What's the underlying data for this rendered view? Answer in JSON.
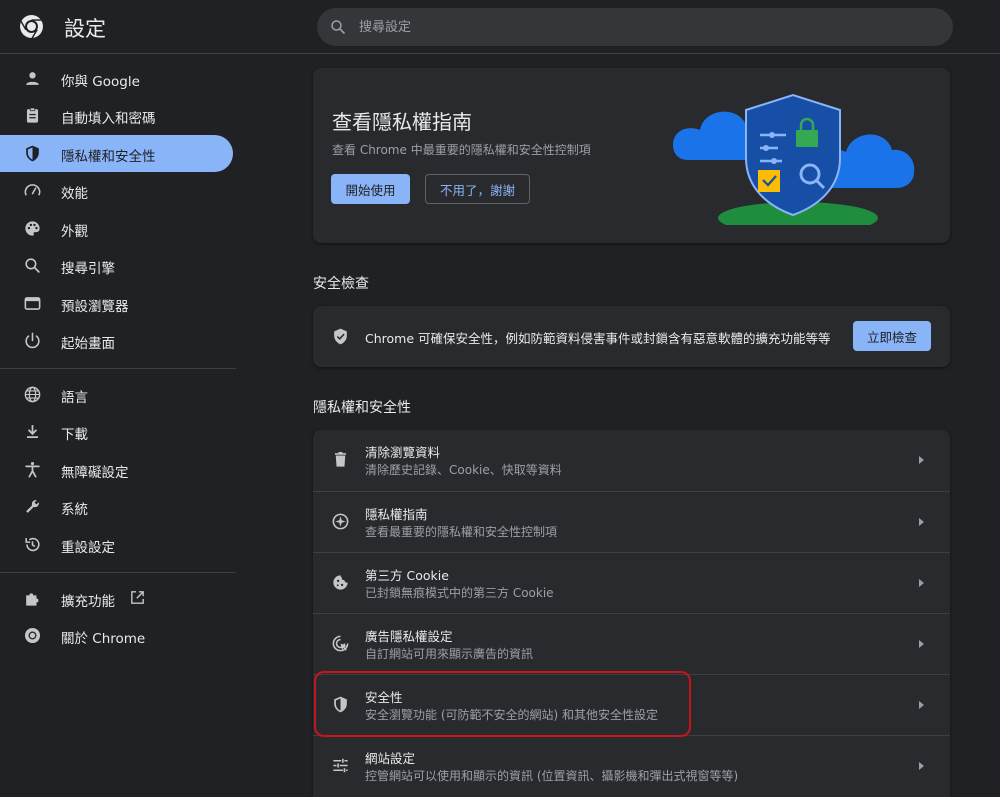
{
  "header": {
    "title": "設定",
    "search_placeholder": "搜尋設定"
  },
  "sidebar": {
    "items": [
      {
        "label": "你與 Google",
        "icon": "person-icon"
      },
      {
        "label": "自動填入和密碼",
        "icon": "clipboard-icon"
      },
      {
        "label": "隱私權和安全性",
        "icon": "shield-icon",
        "active": true
      },
      {
        "label": "效能",
        "icon": "speedometer-icon"
      },
      {
        "label": "外觀",
        "icon": "palette-icon"
      },
      {
        "label": "搜尋引擎",
        "icon": "search-icon"
      },
      {
        "label": "預設瀏覽器",
        "icon": "browser-icon"
      },
      {
        "label": "起始畫面",
        "icon": "power-icon"
      },
      {
        "label": "語言",
        "icon": "globe-icon"
      },
      {
        "label": "下載",
        "icon": "download-icon"
      },
      {
        "label": "無障礙設定",
        "icon": "accessibility-icon"
      },
      {
        "label": "系統",
        "icon": "wrench-icon"
      },
      {
        "label": "重設設定",
        "icon": "history-icon"
      },
      {
        "label": "擴充功能",
        "icon": "puzzle-icon"
      },
      {
        "label": "關於 Chrome",
        "icon": "chrome-icon"
      }
    ]
  },
  "promo": {
    "title": "查看隱私權指南",
    "description": "查看 Chrome 中最重要的隱私權和安全性控制項",
    "start_label": "開始使用",
    "dismiss_label": "不用了，謝謝"
  },
  "safety_check": {
    "heading": "安全檢查",
    "text": "Chrome 可確保安全性，例如防範資料侵害事件或封鎖含有惡意軟體的擴充功能等等",
    "button_label": "立即檢查"
  },
  "privacy": {
    "heading": "隱私權和安全性",
    "rows": [
      {
        "title": "清除瀏覽資料",
        "subtitle": "清除歷史記錄、Cookie、快取等資料",
        "icon": "trash-icon"
      },
      {
        "title": "隱私權指南",
        "subtitle": "查看最重要的隱私權和安全性控制項",
        "icon": "compass-icon"
      },
      {
        "title": "第三方 Cookie",
        "subtitle": "已封鎖無痕模式中的第三方 Cookie",
        "icon": "cookie-icon"
      },
      {
        "title": "廣告隱私權設定",
        "subtitle": "自訂網站可用來顯示廣告的資訊",
        "icon": "ad-privacy-icon"
      },
      {
        "title": "安全性",
        "subtitle": "安全瀏覽功能 (可防範不安全的網站) 和其他安全性設定",
        "icon": "shield-icon"
      },
      {
        "title": "網站設定",
        "subtitle": "控管網站可以使用和顯示的資訊 (位置資訊、攝影機和彈出式視窗等等)",
        "icon": "tune-icon"
      }
    ]
  },
  "colors": {
    "accent": "#8ab4f8",
    "background": "#202124",
    "card": "#292a2d",
    "highlight": "#c4161c"
  }
}
